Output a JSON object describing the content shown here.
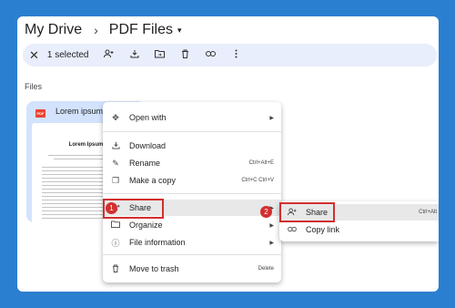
{
  "breadcrumb": {
    "root": "My Drive",
    "separator": "›",
    "current": "PDF Files",
    "caret": "▾"
  },
  "toolbar": {
    "close": "✕",
    "selected": "1 selected",
    "icons": [
      "add-person-icon",
      "download-icon",
      "move-to-folder-icon",
      "trash-icon",
      "link-icon",
      "more-vert-icon"
    ]
  },
  "files_label": "Files",
  "file": {
    "name": "Lorem ipsum",
    "type_badge": "PDF",
    "doc_title": "Lorem Ipsum"
  },
  "context_menu": {
    "open_with": "Open with",
    "download": "Download",
    "rename": "Rename",
    "rename_shortcut": "Ctrl+Alt+E",
    "make_copy": "Make a copy",
    "make_copy_shortcut": "Ctrl+C Ctrl+V",
    "share": "Share",
    "organize": "Organize",
    "file_information": "File information",
    "move_to_trash": "Move to trash",
    "move_to_trash_shortcut": "Delete"
  },
  "share_submenu": {
    "share": "Share",
    "share_shortcut": "Ctrl+Alt",
    "copy_link": "Copy link"
  },
  "step_badges": [
    "1",
    "2"
  ],
  "colors": {
    "highlight": "#d32f2f",
    "background": "#2b7fd1",
    "selected_card": "#d3e3fd"
  }
}
